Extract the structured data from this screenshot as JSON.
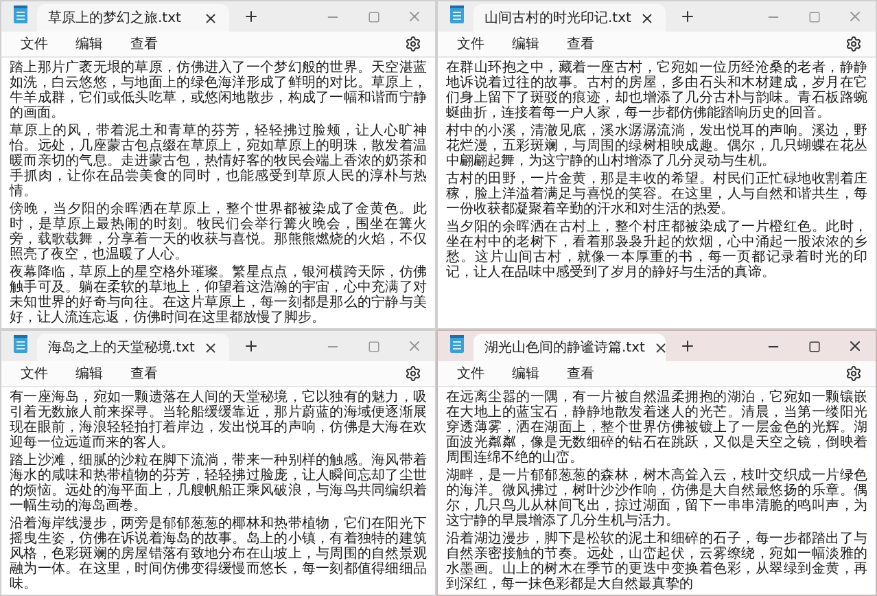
{
  "windows": [
    {
      "tab_title": "草原上的梦幻之旅.txt",
      "active": false,
      "menu": [
        "文件",
        "编辑",
        "查看"
      ],
      "paragraphs": [
        "踏上那片广袤无垠的草原，仿佛进入了一个梦幻般的世界。天空湛蓝如洗，白云悠悠，与地面上的绿色海洋形成了鲜明的对比。草原上，牛羊成群，它们或低头吃草，或悠闲地散步，构成了一幅和谐而宁静的画面。",
        "草原上的风，带着泥土和青草的芬芳，轻轻拂过脸颊，让人心旷神怡。远处，几座蒙古包点缀在草原上，宛如草原上的明珠，散发着温暖而亲切的气息。走进蒙古包，热情好客的牧民会端上香浓的奶茶和手抓肉，让你在品尝美食的同时，也能感受到草原人民的淳朴与热情。",
        "傍晚，当夕阳的余晖洒在草原上，整个世界都被染成了金黄色。此时，是草原上最热闹的时刻。牧民们会举行篝火晚会，围坐在篝火旁，载歌载舞，分享着一天的收获与喜悦。那熊熊燃烧的火焰，不仅照亮了夜空，也温暖了人心。",
        "夜幕降临，草原上的星空格外璀璨。繁星点点，银河横跨天际，仿佛触手可及。躺在柔软的草地上，仰望着这浩瀚的宇宙，心中充满了对未知世界的好奇与向往。在这片草原上，每一刻都是那么的宁静与美好，让人流连忘返，仿佛时间在这里都放慢了脚步。"
      ]
    },
    {
      "tab_title": "山间古村的时光印记.txt",
      "active": false,
      "menu": [
        "文件",
        "编辑",
        "查看"
      ],
      "paragraphs": [
        "在群山环抱之中，藏着一座古村，它宛如一位历经沧桑的老者，静静地诉说着过往的故事。古村的房屋，多由石头和木材建成，岁月在它们身上留下了斑驳的痕迹，却也增添了几分古朴与韵味。青石板路蜿蜒曲折，连接着每一户人家，每一步都仿佛能踏响历史的回音。",
        "村中的小溪，清澈见底，溪水潺潺流淌，发出悦耳的声响。溪边，野花烂漫，五彩斑斓，与周围的绿树相映成趣。偶尔，几只蝴蝶在花丛中翩翩起舞，为这宁静的山村增添了几分灵动与生机。",
        "古村的田野，一片金黄，那是丰收的希望。村民们正忙碌地收割着庄稼，脸上洋溢着满足与喜悦的笑容。在这里，人与自然和谐共生，每一份收获都凝聚着辛勤的汗水和对生活的热爱。",
        "当夕阳的余晖洒在古村上，整个村庄都被染成了一片橙红色。此时，坐在村中的老树下，看着那袅袅升起的炊烟，心中涌起一股浓浓的乡愁。这片山间古村，就像一本厚重的书，每一页都记录着时光的印记，让人在品味中感受到了岁月的静好与生活的真谛。"
      ]
    },
    {
      "tab_title": "海岛之上的天堂秘境.txt",
      "active": false,
      "menu": [
        "文件",
        "编辑",
        "查看"
      ],
      "paragraphs": [
        "有一座海岛，宛如一颗遗落在人间的天堂秘境，它以独有的魅力，吸引着无数旅人前来探寻。当轮船缓缓靠近，那片蔚蓝的海域便逐渐展现在眼前，海浪轻轻拍打着岸边，发出悦耳的声响，仿佛是大海在欢迎每一位远道而来的客人。",
        "踏上沙滩，细腻的沙粒在脚下流淌，带来一种别样的触感。海风带着海水的咸味和热带植物的芬芳，轻轻拂过脸庞，让人瞬间忘却了尘世的烦恼。远处的海平面上，几艘帆船正乘风破浪，与海鸟共同编织着一幅生动的海岛画卷。",
        "沿着海岸线漫步，两旁是郁郁葱葱的椰林和热带植物，它们在阳光下摇曳生姿，仿佛在诉说着海岛的故事。岛上的小镇，有着独特的建筑风格，色彩斑斓的房屋错落有致地分布在山坡上，与周围的自然景观融为一体。在这里，时间仿佛变得缓慢而悠长，每一刻都值得细细品味。"
      ]
    },
    {
      "tab_title": "湖光山色间的静谧诗篇.txt",
      "active": true,
      "menu": [
        "文件",
        "编辑",
        "查看"
      ],
      "paragraphs": [
        "在远离尘嚣的一隅，有一片被自然温柔拥抱的湖泊，它宛如一颗镶嵌在大地上的蓝宝石，静静地散发着迷人的光芒。清晨，当第一缕阳光穿透薄雾，洒在湖面上，整个世界仿佛被镀上了一层金色的光辉。湖面波光粼粼，像是无数细碎的钻石在跳跃，又似是天空之镜，倒映着周围连绵不绝的山峦。",
        "湖畔，是一片郁郁葱葱的森林，树木高耸入云，枝叶交织成一片绿色的海洋。微风拂过，树叶沙沙作响，仿佛是大自然最悠扬的乐章。偶尔，几只鸟儿从林间飞出，掠过湖面，留下一串串清脆的鸣叫声，为这宁静的早晨增添了几分生机与活力。",
        "沿着湖边漫步，脚下是松软的泥土和细碎的石子，每一步都踏出了与自然亲密接触的节奏。远处，山峦起伏，云雾缭绕，宛如一幅淡雅的水墨画。山上的树木在季节的更迭中变换着色彩，从翠绿到金黄，再到深红，每一抹色彩都是大自然最真挚的"
      ]
    }
  ]
}
